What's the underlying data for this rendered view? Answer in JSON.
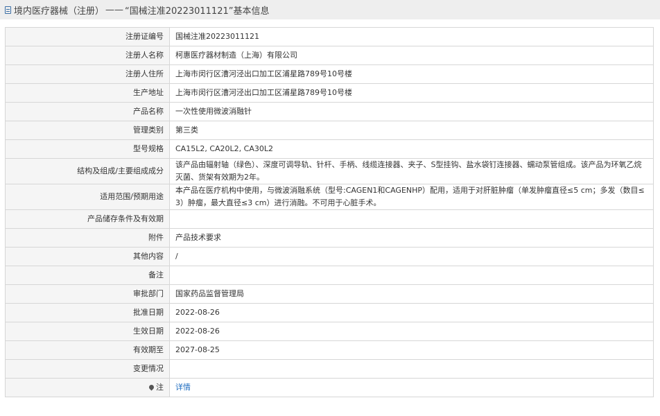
{
  "header": {
    "icon": "document-icon",
    "category": "境内医疗器械（注册）",
    "separator": "——",
    "title": "“国械注准20223011121”基本信息"
  },
  "rows": [
    {
      "label": "注册证编号",
      "value": "国械注准20223011121"
    },
    {
      "label": "注册人名称",
      "value": "柯惠医疗器材制造（上海）有限公司"
    },
    {
      "label": "注册人住所",
      "value": "上海市闵行区漕河泾出口加工区浦星路789号10号楼"
    },
    {
      "label": "生产地址",
      "value": "上海市闵行区漕河泾出口加工区浦星路789号10号楼"
    },
    {
      "label": "产品名称",
      "value": "一次性使用微波消融针"
    },
    {
      "label": "管理类别",
      "value": "第三类"
    },
    {
      "label": "型号规格",
      "value": "CA15L2, CA20L2, CA30L2"
    },
    {
      "label": "结构及组成/主要组成成分",
      "value": "该产品由辐射轴（绿色）、深度可调导轨、针杆、手柄、线缆连接器、夹子、S型挂钩、盐水袋钉连接器、蠕动泵管组成。该产品为环氧乙烷灭菌、货架有效期为2年。"
    },
    {
      "label": "适用范围/预期用途",
      "value": "本产品在医疗机构中使用，与微波消融系统（型号:CAGEN1和CAGENHP）配用，适用于对肝脏肿瘤（单发肿瘤直径≤5 cm；多发（数目≤3）肿瘤，最大直径≤3 cm）进行消融。不可用于心脏手术。"
    },
    {
      "label": "产品储存条件及有效期",
      "value": ""
    },
    {
      "label": "附件",
      "value": "产品技术要求"
    },
    {
      "label": "其他内容",
      "value": "/"
    },
    {
      "label": "备注",
      "value": ""
    },
    {
      "label": "审批部门",
      "value": "国家药品监督管理局"
    },
    {
      "label": "批准日期",
      "value": "2022-08-26"
    },
    {
      "label": "生效日期",
      "value": "2022-08-26"
    },
    {
      "label": "有效期至",
      "value": "2027-08-25"
    },
    {
      "label": "变更情况",
      "value": ""
    }
  ],
  "note": {
    "icon": "lightbulb-icon",
    "label": "注",
    "link_text": "详情"
  },
  "colors": {
    "title_bar_bg": "#eeeeee",
    "label_bg": "#f5f5f5",
    "border": "#d6d6d6",
    "link": "#1f6dc0"
  }
}
